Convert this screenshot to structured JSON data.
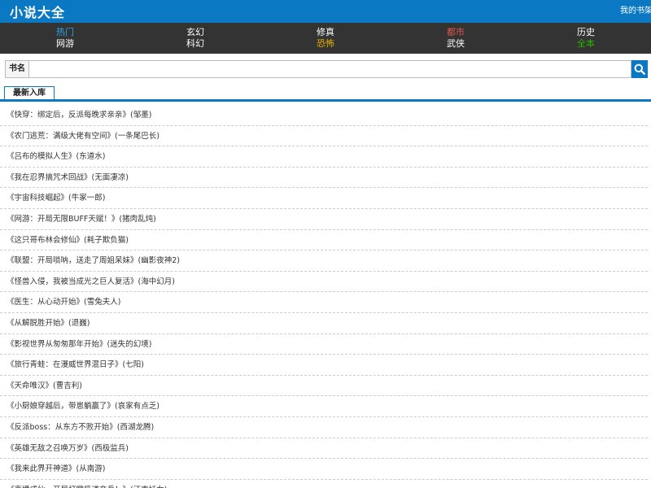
{
  "header": {
    "logo": "小说大全",
    "my_shelf": "我的书架"
  },
  "colors": {
    "brand_blue": "#0b78c4",
    "nav_bg": "#333333",
    "hot": "#2aa6e8",
    "city": "#e2574c",
    "horror": "#e8b000",
    "complete": "#2db400"
  },
  "nav": {
    "columns": [
      {
        "top": {
          "label": "热门",
          "color": "#2aa6e8"
        },
        "bottom": {
          "label": "网游",
          "color": "#ffffff"
        }
      },
      {
        "top": {
          "label": "玄幻",
          "color": "#ffffff"
        },
        "bottom": {
          "label": "科幻",
          "color": "#ffffff"
        }
      },
      {
        "top": {
          "label": "修真",
          "color": "#ffffff"
        },
        "bottom": {
          "label": "恐怖",
          "color": "#e8b000"
        }
      },
      {
        "top": {
          "label": "都市",
          "color": "#e2574c"
        },
        "bottom": {
          "label": "武侠",
          "color": "#ffffff"
        }
      },
      {
        "top": {
          "label": "历史",
          "color": "#ffffff"
        },
        "bottom": {
          "label": "全本",
          "color": "#2db400"
        }
      }
    ]
  },
  "search": {
    "label": "书名",
    "value": "",
    "placeholder": "",
    "icon": "search-icon"
  },
  "section": {
    "title": "最新入库"
  },
  "books": [
    "《快穿：绑定后，反派每晚求亲亲》(邹墨)",
    "《农门逃荒：满级大佬有空间》(一条尾巴长)",
    "《吕布的模拟人生》(东道水)",
    "《我在忍界搞咒术回战》(无面凄凉)",
    "《宇宙科技崛起》(牛家一郎)",
    "《网游：开局无限BUFF天赋！》(猪肉乱炖)",
    "《这只哥布林会修仙》(耗子欺负猫)",
    "《联盟：开局唢呐，送走了周姐呆妹》(幽影夜神2)",
    "《怪兽入侵，我被当成光之巨人复活》(海中幻月)",
    "《医生：从心动开始》(雪兔夫人)",
    "《从解脱胜开始》(退巍)",
    "《影视世界从匆匆那年开始》(迷失的幻境)",
    "《旅行青蛙：在漫威世界混日子》(七阳)",
    "《天命唯汉》(曹吉利)",
    "《小厨娘穿越后，带崽躺赢了》(哀家有点乏)",
    "《反派boss：从东方不败开始》(西湖龙腾)",
    "《英雄无敌之召唤万岁》(西极监兵)",
    "《我来此界开神道》(从南游)",
    "《直播成仙，开局打赏极道帝兵！》(江南妖女)"
  ]
}
